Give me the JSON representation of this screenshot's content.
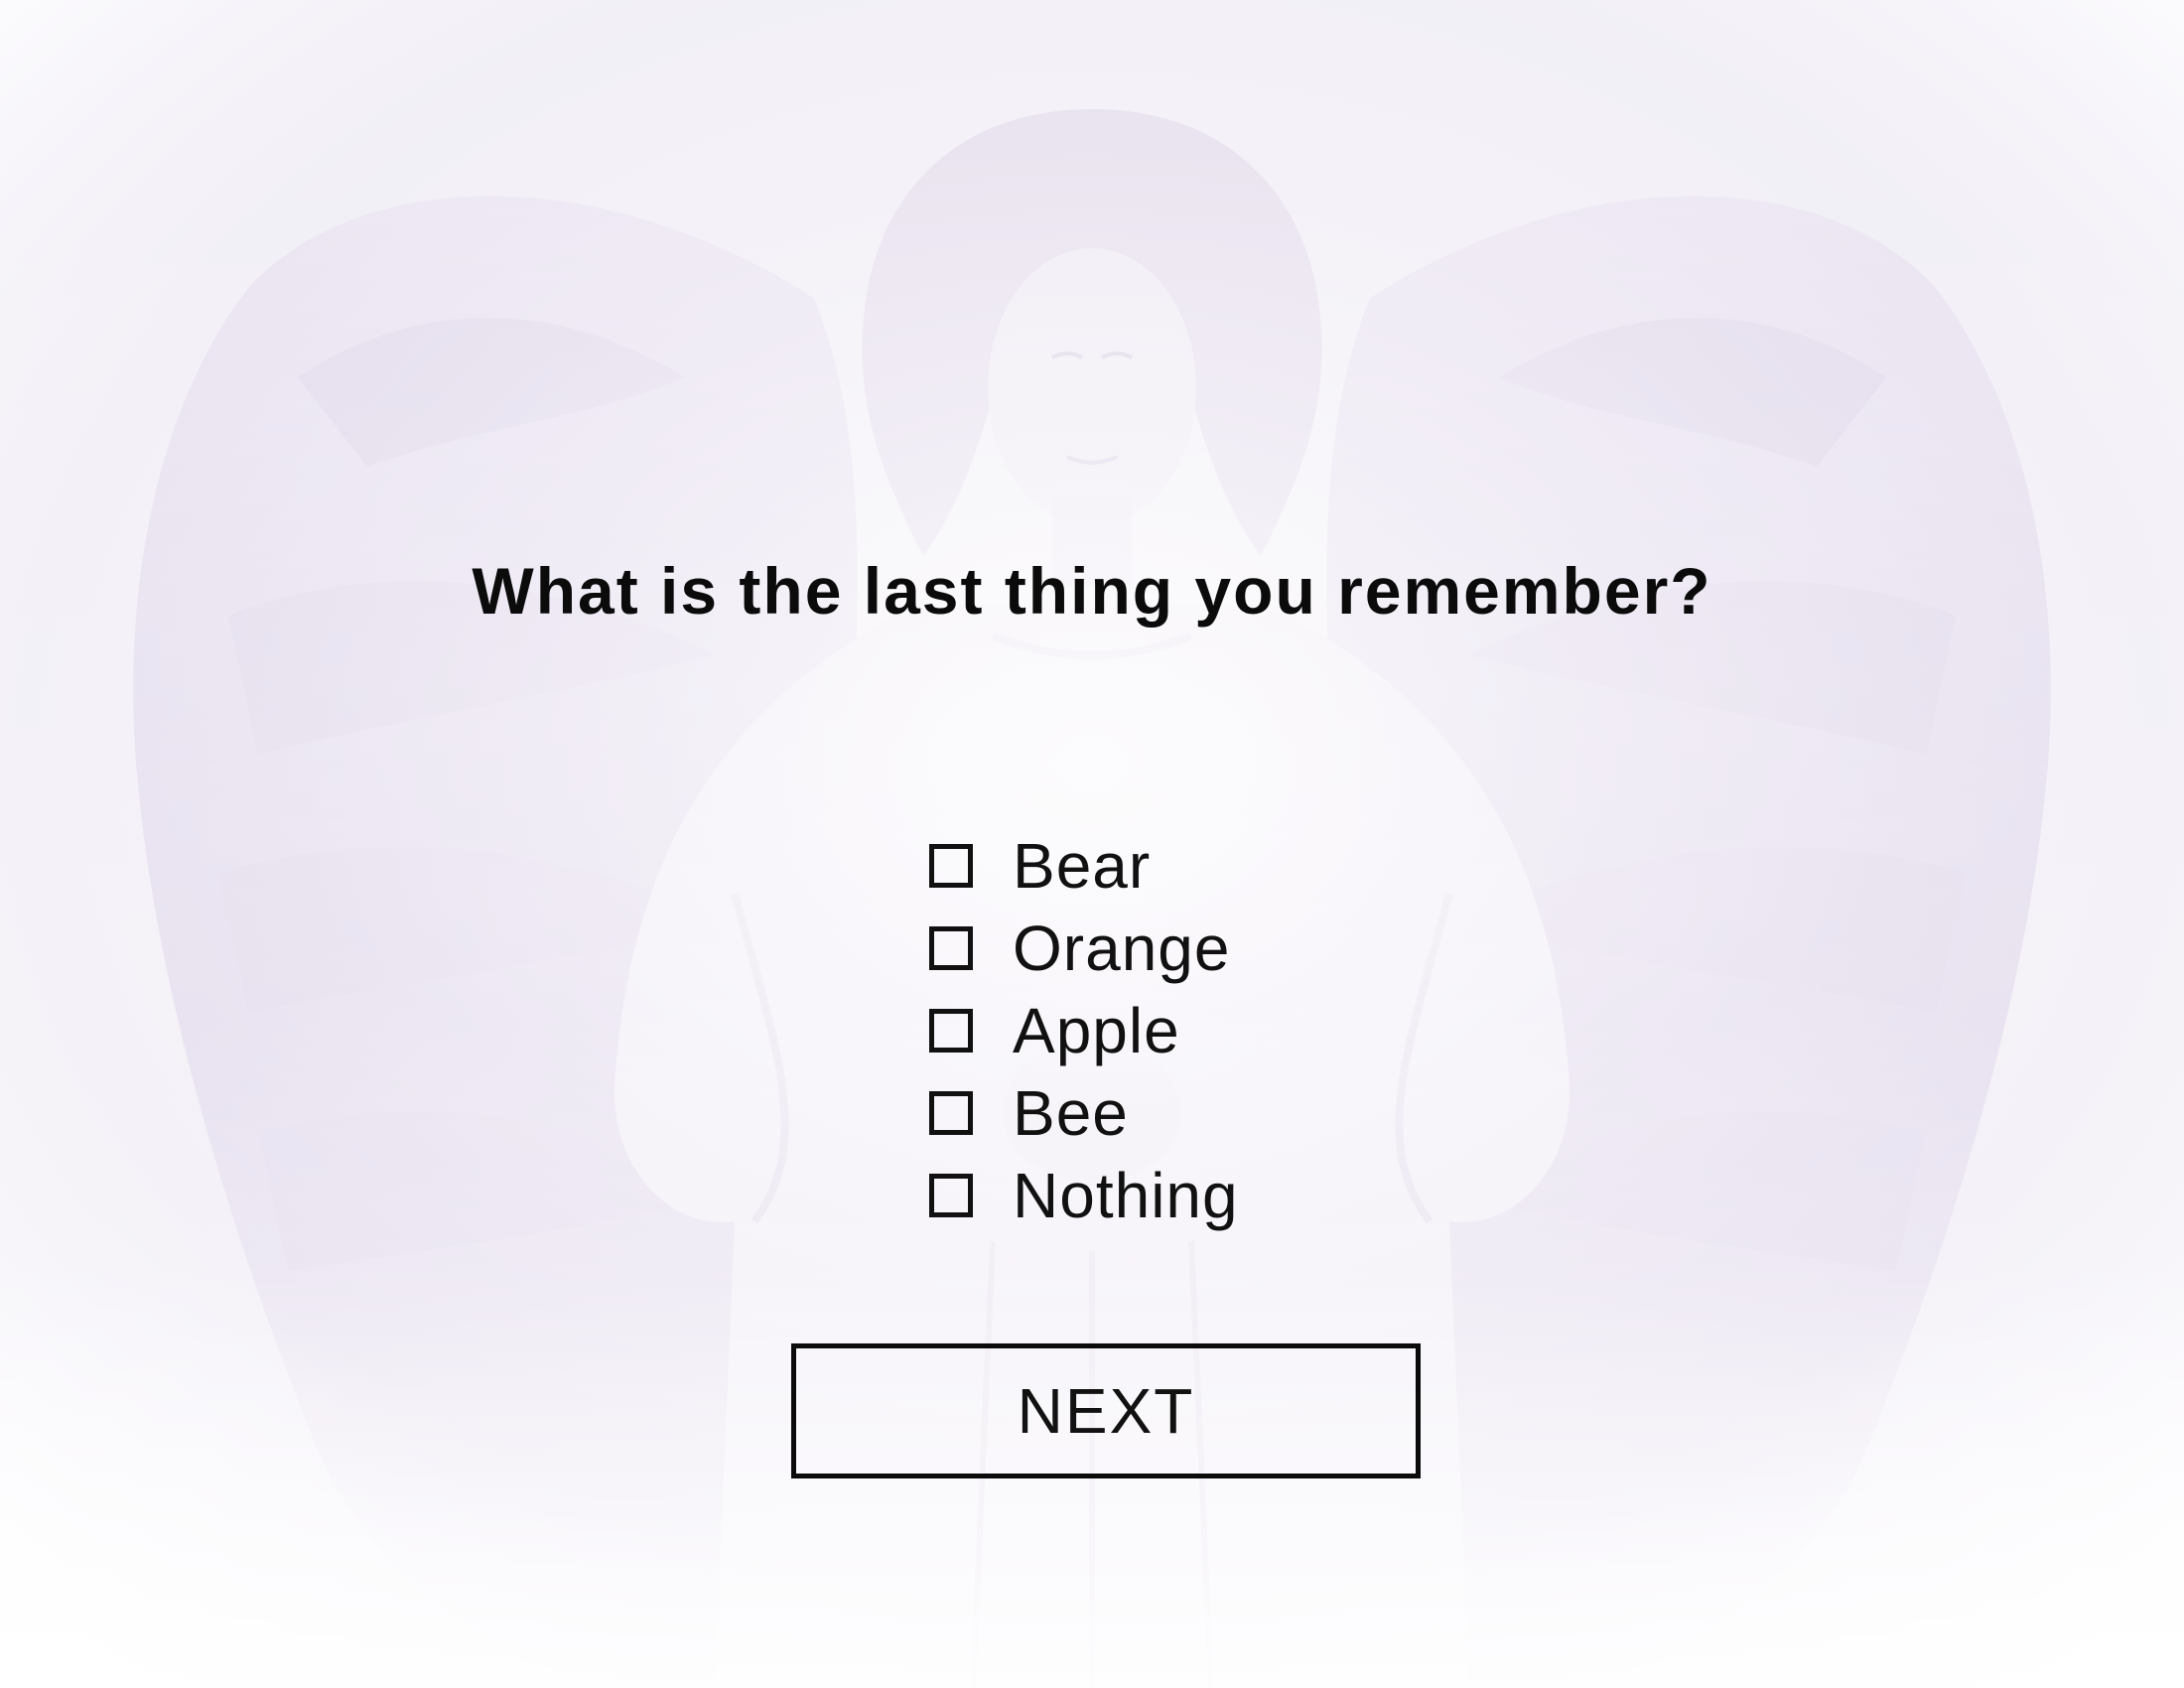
{
  "question": {
    "text": "What is the last thing you remember?"
  },
  "options": [
    {
      "label": "Bear",
      "checked": false
    },
    {
      "label": "Orange",
      "checked": false
    },
    {
      "label": "Apple",
      "checked": false
    },
    {
      "label": "Bee",
      "checked": false
    },
    {
      "label": "Nothing",
      "checked": false
    }
  ],
  "next_button": {
    "label": "NEXT"
  },
  "colors": {
    "background": "#f3f0f7",
    "wing_tint": "#d9cfe6",
    "text": "#111111"
  },
  "background_image": {
    "icon": "angel-illustration"
  }
}
